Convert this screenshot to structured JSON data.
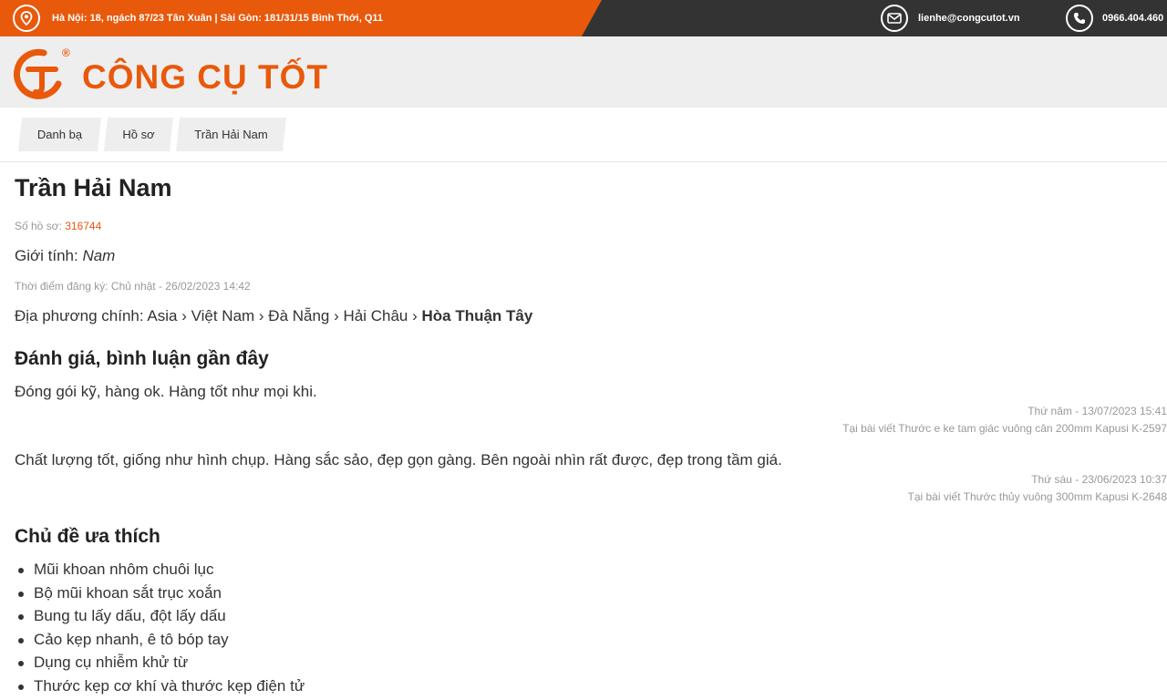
{
  "topbar": {
    "address": "Hà Nội: 18, ngách 87/23 Tân Xuân | Sài Gòn: 181/31/15 Bình Thới, Q11",
    "email": "lienhe@congcutot.vn",
    "phone": "0966.404.460",
    "icons": [
      "map-pin-icon",
      "mail-icon",
      "phone-icon"
    ]
  },
  "header": {
    "logo_text": "CÔNG CỤ TỐT",
    "logo_mark": "CT",
    "registered": "®"
  },
  "breadcrumb": [
    {
      "label": "Danh bạ"
    },
    {
      "label": "Hồ sơ"
    },
    {
      "label": "Trần Hải Nam"
    }
  ],
  "profile": {
    "name": "Trần Hải Nam",
    "number_label": "Số hồ sơ: ",
    "number": "316744",
    "gender_label": "Giới tính: ",
    "gender": "Nam",
    "registered_label": "Thời điểm đăng ký: ",
    "registered_at": "Chủ nhật - 26/02/2023 14:42",
    "locality_label": "Địa phương chính: ",
    "locality_path": "Asia › Việt Nam › Đà Nẵng › Hải Châu › ",
    "locality_last": "Hòa Thuận Tây"
  },
  "reviews": {
    "title": "Đánh giá, bình luận gần đây",
    "items": [
      {
        "text": "Đóng gói kỹ, hàng ok. Hàng tốt như mọi khi.",
        "date": "Thứ năm - 13/07/2023 15:41",
        "source": "Tại bài viết Thước e ke tam giác vuông cân 200mm Kapusi K-2597"
      },
      {
        "text": "Chất lượng tốt, giống như hình chụp. Hàng sắc sảo, đẹp gọn gàng. Bên ngoài nhìn rất được, đẹp trong tầm giá.",
        "date": "Thứ sáu - 23/06/2023 10:37",
        "source": "Tại bài viết Thước thủy vuông 300mm Kapusi K-2648"
      }
    ]
  },
  "favorites": {
    "title": "Chủ đề ưa thích",
    "items": [
      "Mũi khoan nhôm chuôi lục",
      "Bộ mũi khoan sắt trục xoắn",
      "Bung tu lấy dấu, đột lấy dấu",
      "Cảo kẹp nhanh, ê tô bóp tay",
      "Dụng cụ nhiễm khử từ",
      "Thước kẹp cơ khí và thước kẹp điện tử"
    ]
  },
  "colors": {
    "accent": "#e8590c",
    "topbar_dark": "#333333",
    "header_bg": "#eeeeee"
  }
}
